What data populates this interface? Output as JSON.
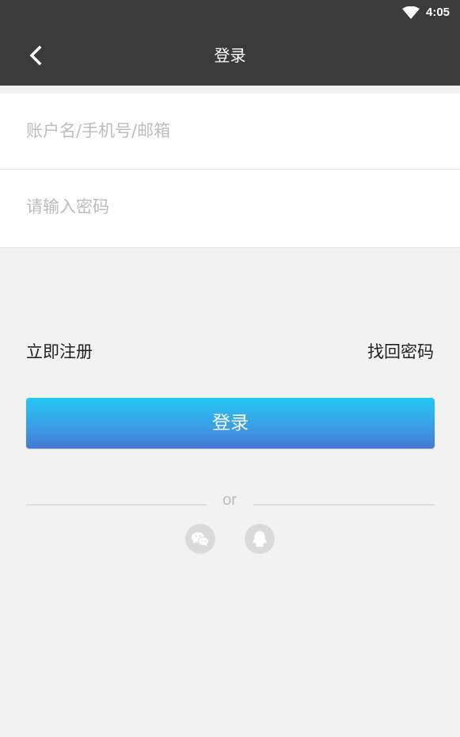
{
  "status_bar": {
    "time": "4:05",
    "wifi_icon": "wifi-icon"
  },
  "app_bar": {
    "back_icon": "chevron-left-icon",
    "title": "登录"
  },
  "form": {
    "username_placeholder": "账户名/手机号/邮箱",
    "username_value": "",
    "password_placeholder": "请输入密码",
    "password_value": ""
  },
  "links": {
    "register": "立即注册",
    "forgot_password": "找回密码"
  },
  "login_button": {
    "label": "登录"
  },
  "divider": {
    "or_text": "or"
  },
  "social_login": [
    {
      "icon": "wechat-icon"
    },
    {
      "icon": "qq-icon"
    }
  ],
  "colors": {
    "app_bar_bg": "#3b3b3b",
    "page_bg": "#f2f2f2",
    "button_gradient_top": "#25c7f4",
    "button_gradient_bottom": "#4479d4",
    "placeholder": "#bcbcbc"
  }
}
